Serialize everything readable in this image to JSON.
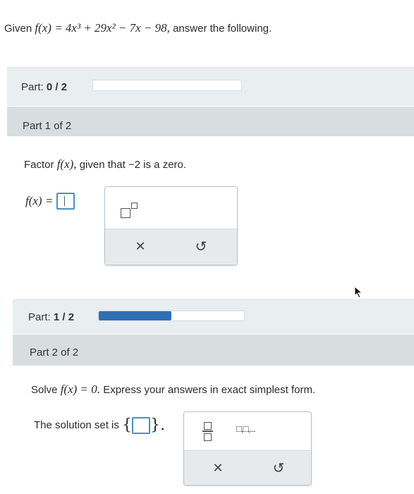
{
  "header": {
    "given_prefix": "Given",
    "function_expr": "f(x) = 4x³ + 29x² − 7x − 98,",
    "given_suffix": "answer the following."
  },
  "progress_top": {
    "label_prefix": "Part:",
    "label_value": "0 / 2",
    "fraction": 0.0
  },
  "part1": {
    "heading": "Part 1 of 2",
    "prompt_prefix": "Factor",
    "prompt_func": "f(x),",
    "prompt_suffix": "given that −2 is a zero.",
    "input_label": "f(x) ="
  },
  "progress_mid": {
    "label_prefix": "Part:",
    "label_value": "1 / 2",
    "fraction": 0.5
  },
  "part2": {
    "heading": "Part 2 of 2",
    "prompt_prefix": "Solve",
    "prompt_eq": "f(x) = 0.",
    "prompt_suffix": "Express your answers in exact simplest form.",
    "solution_label": "The solution set is",
    "set_open": "{",
    "set_close": "}.",
    "list_glyph": "□,□,..."
  },
  "toolbox": {
    "clear_glyph": "✕",
    "undo_glyph": "↺"
  },
  "colors": {
    "accent": "#2f6fb4",
    "input_border": "#4a90c2",
    "part_bar": "#e9eef1",
    "section_head": "#d8dde0"
  }
}
